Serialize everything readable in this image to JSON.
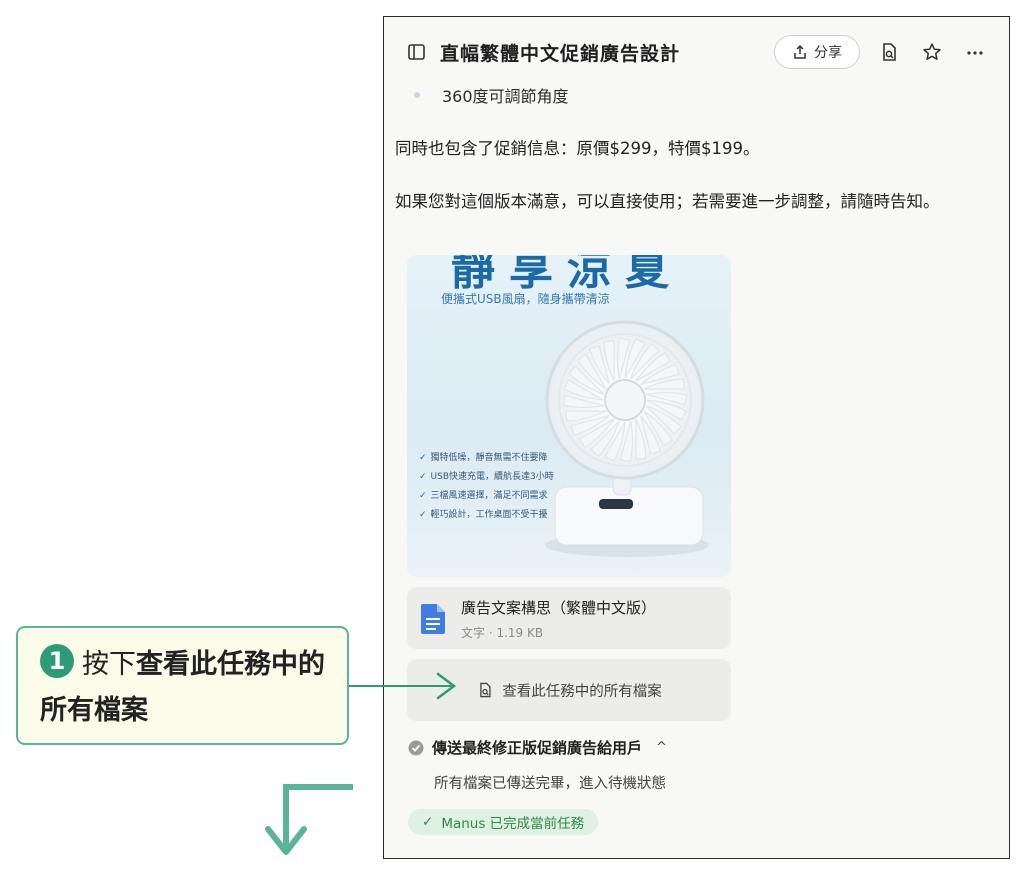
{
  "window": {
    "title": "直幅繁體中文促銷廣告設計",
    "share_label": "分享",
    "icons": [
      "panel-icon",
      "share-icon",
      "files-icon",
      "star-icon",
      "more-icon"
    ]
  },
  "content": {
    "bullet": "360度可調節角度",
    "paragraph1": "同時也包含了促銷信息：原價$299，特價$199。",
    "paragraph2": "如果您對這個版本滿意，可以直接使用；若需要進一步調整，請隨時告知。"
  },
  "poster": {
    "title": "靜享涼夏",
    "subtitle": "便攜式USB風扇，隨身攜帶清涼",
    "features": [
      "獨特低噪，靜音無需不住要降",
      "USB快速充電，續航長達3小時",
      "三檔風速選擇，滿足不同需求",
      "輕巧設計，工作桌面不受干擾"
    ]
  },
  "file_card": {
    "name": "廣告文案構思（繁體中文版）",
    "meta": "文字 · 1.19 KB"
  },
  "view_all_button": {
    "label": "查看此任務中的所有檔案"
  },
  "step": {
    "title": "傳送最終修正版促銷廣告給用戶",
    "caret": "^",
    "description": "所有檔案已傳送完畢，進入待機狀態"
  },
  "status_badge": {
    "label": "Manus 已完成當前任務"
  },
  "callout": {
    "number": "1",
    "prefix": "按下",
    "emphasis": "查看此任務中的所有檔案"
  },
  "colors": {
    "accent_green": "#2f9a76",
    "callout_bg": "#fbfbea",
    "badge_text": "#2f8a44",
    "poster_blue": "#1a6aa8"
  }
}
